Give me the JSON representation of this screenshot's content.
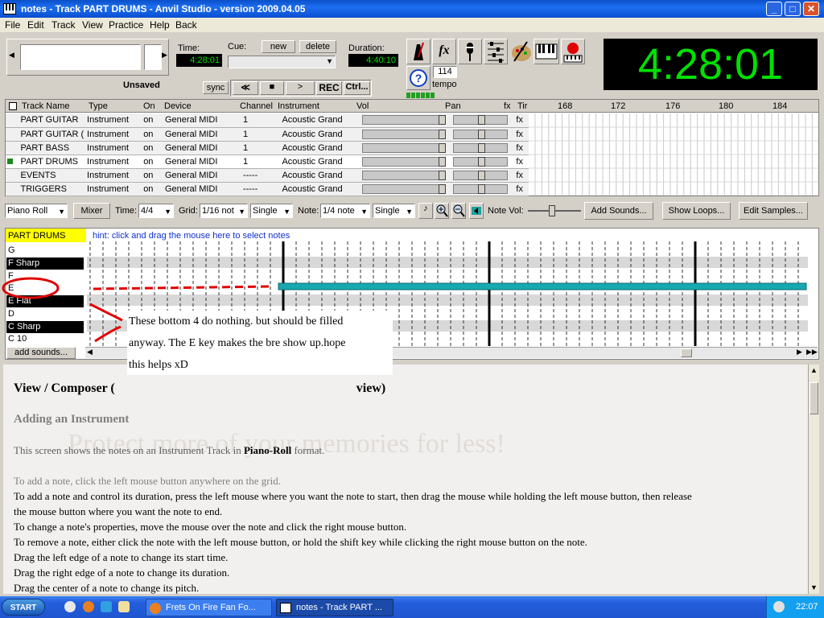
{
  "window": {
    "title": "notes - Track PART DRUMS - Anvil Studio - version 2009.04.05",
    "min": "_",
    "max": "□",
    "close": "✕"
  },
  "menu": [
    "File",
    "Edit",
    "Track",
    "View",
    "Practice",
    "Help",
    "Back"
  ],
  "toolbar": {
    "time_label": "Time:",
    "time_value": "4:28:01",
    "cue_label": "Cue:",
    "cue_new": "new",
    "cue_delete": "delete",
    "duration_label": "Duration:",
    "duration_value": "4:40:10",
    "unsaved": "Unsaved",
    "sync": "sync",
    "rewind": "≪",
    "stop": "■",
    "play": ">",
    "rec": "REC",
    "ctrl": "Ctrl...",
    "tempo_value": "114",
    "tempo_label": "tempo",
    "big_clock": "4:28:01",
    "fx": "fx"
  },
  "tracks": {
    "headers": [
      "Track Name",
      "Type",
      "On",
      "Device",
      "Channel",
      "Instrument",
      "Vol",
      "Pan",
      "fx",
      "Tir"
    ],
    "timeline": [
      "168",
      "172",
      "176",
      "180",
      "184"
    ],
    "rows": [
      {
        "name": "PART GUITAR",
        "type": "Instrument",
        "on": "on",
        "device": "General MIDI",
        "channel": "1",
        "instrument": "Acoustic Grand",
        "fx": "fx",
        "selected": false
      },
      {
        "name": "PART GUITAR (",
        "type": "Instrument",
        "on": "on",
        "device": "General MIDI",
        "channel": "1",
        "instrument": "Acoustic Grand",
        "fx": "fx",
        "selected": false
      },
      {
        "name": "PART BASS",
        "type": "Instrument",
        "on": "on",
        "device": "General MIDI",
        "channel": "1",
        "instrument": "Acoustic Grand",
        "fx": "fx",
        "selected": false
      },
      {
        "name": "PART DRUMS",
        "type": "Instrument",
        "on": "on",
        "device": "General MIDI",
        "channel": "1",
        "instrument": "Acoustic Grand",
        "fx": "fx",
        "selected": true
      },
      {
        "name": "EVENTS",
        "type": "Instrument",
        "on": "on",
        "device": "General MIDI",
        "channel": "-----",
        "instrument": "Acoustic Grand",
        "fx": "fx",
        "selected": false
      },
      {
        "name": "TRIGGERS",
        "type": "Instrument",
        "on": "on",
        "device": "General MIDI",
        "channel": "-----",
        "instrument": "Acoustic Grand",
        "fx": "fx",
        "selected": false
      }
    ]
  },
  "editor": {
    "view_select": "Piano Roll",
    "mixer": "Mixer",
    "time_label": "Time:",
    "time_sig": "4/4",
    "grid_label": "Grid:",
    "grid_value": "1/16 not",
    "grid_mode": "Single",
    "note_label": "Note:",
    "note_value": "1/4 note",
    "note_mode": "Single",
    "note_vol_label": "Note Vol:",
    "add_sounds": "Add Sounds...",
    "show_loops": "Show Loops...",
    "edit_samples": "Edit Samples...",
    "track_label": "PART DRUMS",
    "hint": "hint: click and drag the mouse here to select notes",
    "keys": [
      "G",
      "F Sharp",
      "F",
      "E",
      "E Flat",
      "D",
      "C Sharp",
      "C 10"
    ],
    "add_sounds_small": "add sounds...",
    "annotation": [
      "These bottom 4 do nothing. but should be filled",
      "anyway. The E key makes the bre show up.hope",
      "this helps xD"
    ]
  },
  "doc": {
    "heading": "View / Composer (",
    "heading_tail": "view)",
    "subheading": "Adding an Instrument",
    "intro": [
      "This screen shows the notes on an Instrument Track in ",
      "Piano-Roll",
      " format."
    ],
    "lines": [
      "To add a note, click the left mouse button anywhere on the grid.",
      "To add a note and control its duration, press the left mouse where you want the note to start, then drag the mouse while holding the left mouse button, then release",
      "the mouse button where you want the note to end.",
      "To change a note's properties, move the mouse over the note and click the right mouse button.",
      "To remove a note, either click the note with the left mouse button, or hold the shift key while clicking the right mouse button on the note.",
      "Drag the left edge of a note to change its start time.",
      "Drag the right edge of a note to change its duration.",
      "Drag the center of a note to change its pitch."
    ],
    "watermark": "Protect more of your memories for less!"
  },
  "taskbar": {
    "start": "START",
    "tasks": [
      "Frets On Fire Fan Fo...",
      "notes - Track PART ..."
    ],
    "clock": "22:07"
  }
}
